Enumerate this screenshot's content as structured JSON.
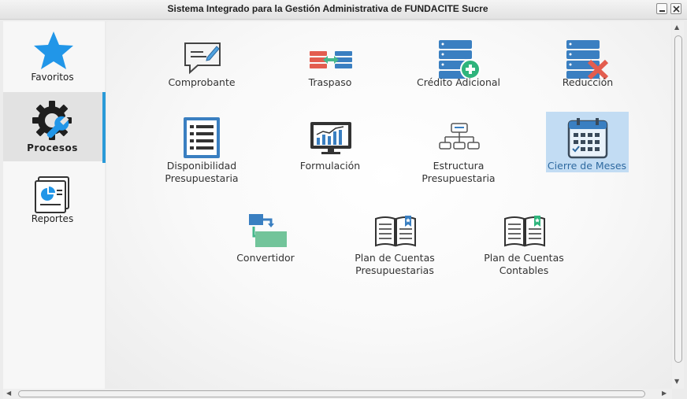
{
  "window": {
    "title": "Sistema Integrado para la Gestión Administrativa de FUNDACITE Sucre"
  },
  "sidebar": {
    "items": [
      {
        "label": "Favoritos",
        "icon": "star-icon",
        "active": false
      },
      {
        "label": "Procesos",
        "icon": "gear-wrench-icon",
        "active": true
      },
      {
        "label": "Reportes",
        "icon": "report-icon",
        "active": false
      }
    ]
  },
  "main": {
    "tiles": [
      {
        "label": "Comprobante",
        "icon": "comment-edit-icon"
      },
      {
        "label": "Traspaso",
        "icon": "transfer-icon"
      },
      {
        "label": "Crédito Adicional",
        "icon": "database-add-icon"
      },
      {
        "label": "Reducción",
        "icon": "database-remove-icon"
      },
      {
        "label": "Disponibilidad Presupuestaria",
        "icon": "checklist-icon"
      },
      {
        "label": "Formulación",
        "icon": "chart-monitor-icon"
      },
      {
        "label": "Estructura Presupuestaria",
        "icon": "hierarchy-icon"
      },
      {
        "label": "Cierre de Meses",
        "icon": "calendar-icon",
        "selected": true
      },
      {
        "label": "Convertidor",
        "icon": "converter-icon"
      },
      {
        "label": "Plan de Cuentas Presupuestarias",
        "icon": "book-blue-icon"
      },
      {
        "label": "Plan de Cuentas Contables",
        "icon": "book-green-icon"
      }
    ]
  },
  "colors": {
    "accent": "#2a9ad8",
    "selection": "#c2dcf3",
    "star": "#2196e8"
  }
}
